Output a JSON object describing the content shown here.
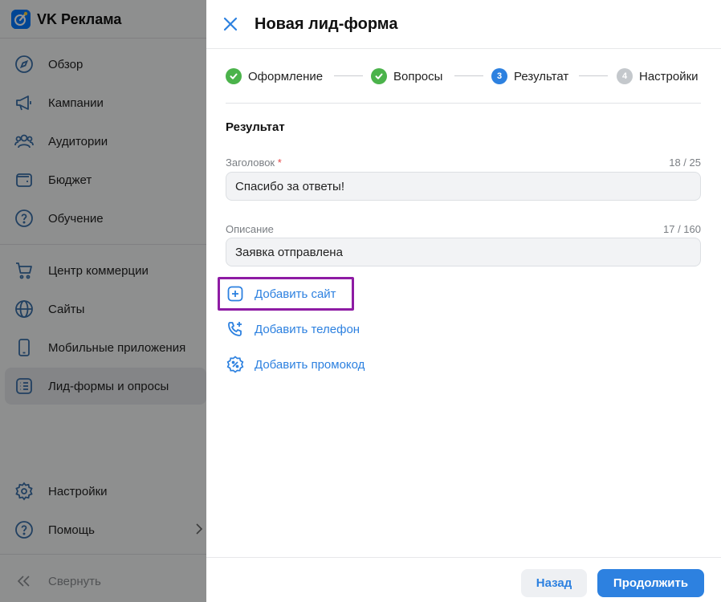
{
  "brand": {
    "name": "VK Реклама"
  },
  "sidebar": {
    "items": [
      {
        "label": "Обзор",
        "icon": "compass-icon"
      },
      {
        "label": "Кампании",
        "icon": "megaphone-icon"
      },
      {
        "label": "Аудитории",
        "icon": "users-icon"
      },
      {
        "label": "Бюджет",
        "icon": "wallet-icon"
      },
      {
        "label": "Обучение",
        "icon": "help-icon"
      },
      {
        "label": "Центр коммерции",
        "icon": "cart-icon"
      },
      {
        "label": "Сайты",
        "icon": "globe-icon"
      },
      {
        "label": "Мобильные приложения",
        "icon": "phone-icon"
      },
      {
        "label": "Лид-формы и опросы",
        "icon": "list-icon",
        "active": true
      },
      {
        "label": "Настройки",
        "icon": "gear-icon"
      },
      {
        "label": "Помощь",
        "icon": "help-icon"
      }
    ],
    "collapse_label": "Свернуть"
  },
  "panel": {
    "title": "Новая лид-форма",
    "steps": [
      {
        "label": "Оформление",
        "state": "done"
      },
      {
        "label": "Вопросы",
        "state": "done"
      },
      {
        "label": "Результат",
        "state": "current",
        "number": "3"
      },
      {
        "label": "Настройки",
        "state": "todo",
        "number": "4"
      }
    ],
    "section_title": "Результат",
    "fields": {
      "heading": {
        "label": "Заголовок",
        "required_mark": "*",
        "counter": "18 / 25",
        "value": "Спасибо за ответы!"
      },
      "description": {
        "label": "Описание",
        "counter": "17 / 160",
        "value": "Заявка отправлена"
      }
    },
    "actions": {
      "add_site": "Добавить сайт",
      "add_phone": "Добавить телефон",
      "add_promo": "Добавить промокод"
    },
    "buttons": {
      "back": "Назад",
      "next": "Продолжить"
    }
  },
  "colors": {
    "accent": "#2d81e0",
    "done": "#4bb34b",
    "highlight": "#8e1ba4"
  }
}
